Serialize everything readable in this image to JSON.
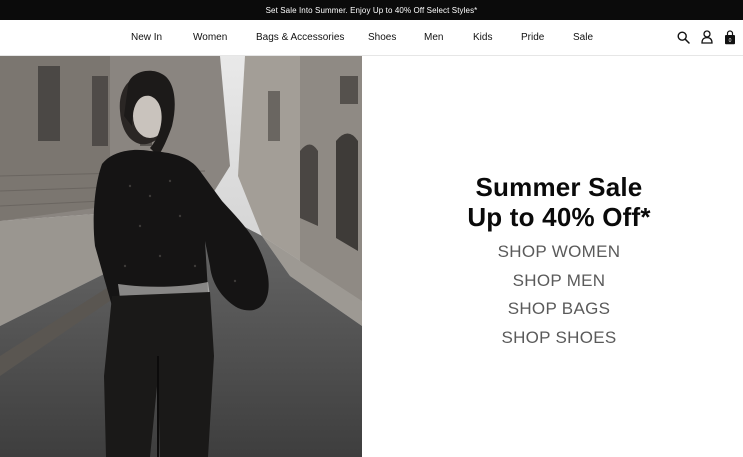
{
  "promo": {
    "text": "Set Sale Into Summer. Enjoy Up to 40% Off Select Styles*"
  },
  "nav": {
    "items": [
      {
        "label": "New In"
      },
      {
        "label": "Women"
      },
      {
        "label": "Bags & Accessories"
      },
      {
        "label": "Shoes"
      },
      {
        "label": "Men"
      },
      {
        "label": "Kids"
      },
      {
        "label": "Pride"
      },
      {
        "label": "Sale"
      }
    ],
    "bag_count": "0"
  },
  "hero": {
    "headline_line1": "Summer Sale",
    "headline_line2": "Up to 40% Off*",
    "links": [
      {
        "label": "SHOP WOMEN"
      },
      {
        "label": "SHOP MEN"
      },
      {
        "label": "SHOP BAGS"
      },
      {
        "label": "SHOP SHOES"
      }
    ]
  }
}
